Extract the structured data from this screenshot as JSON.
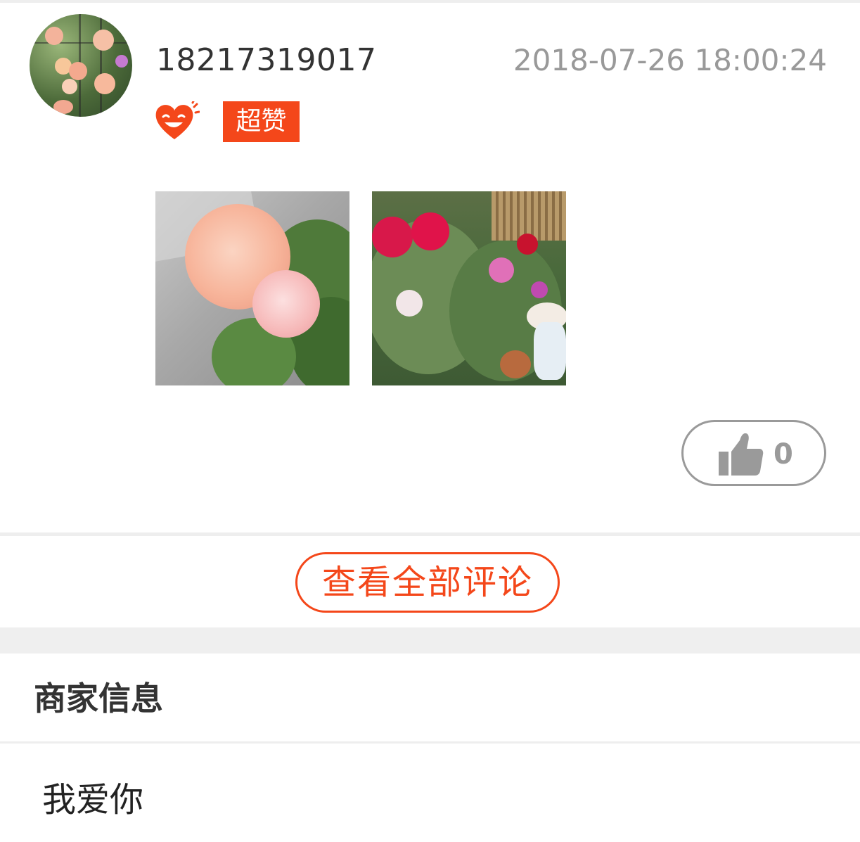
{
  "review": {
    "username": "18217319017",
    "timestamp": "2018-07-26 18:00:24",
    "rating_icon": "smiling-heart-icon",
    "rating_label": "超赞",
    "like_icon": "thumbs-up-icon",
    "like_count": "0"
  },
  "actions": {
    "view_all_comments": "查看全部评论"
  },
  "merchant": {
    "section_title": "商家信息",
    "content": "我爱你"
  },
  "colors": {
    "accent": "#f4471a",
    "muted": "#999999",
    "text": "#333333",
    "divider": "#eeeeee"
  }
}
